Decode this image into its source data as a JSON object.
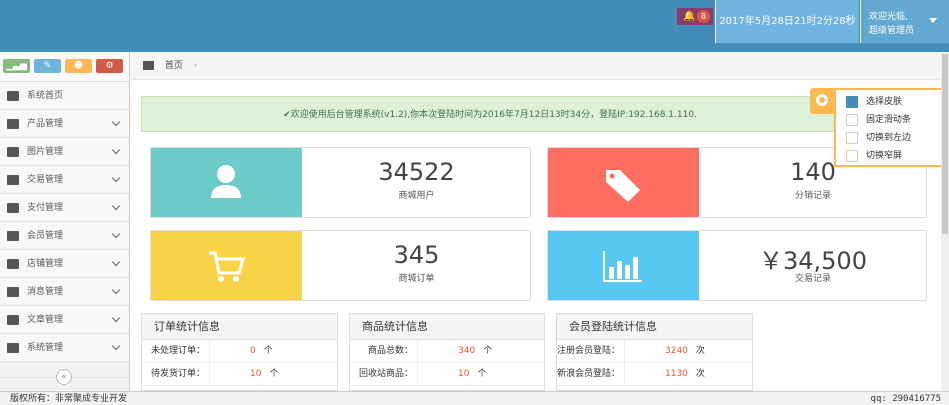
{
  "header": {
    "notification_count": "8",
    "datetime": "2017年5月28日21时2分28秒",
    "user_line1": "欢迎光临,",
    "user_line2": "超级管理员"
  },
  "shortcuts": [
    {
      "icon": "signal-icon",
      "color": "#87b87f"
    },
    {
      "icon": "pencil-icon",
      "color": "#6fb3e0"
    },
    {
      "icon": "users-icon",
      "color": "#ffb752"
    },
    {
      "icon": "cogs-icon",
      "color": "#d15b47"
    }
  ],
  "sidebar": {
    "items": [
      {
        "label": "系统首页",
        "icon": "home-icon"
      },
      {
        "label": "产品管理",
        "icon": "desktop-icon"
      },
      {
        "label": "图片管理",
        "icon": "picture-icon"
      },
      {
        "label": "交易管理",
        "icon": "list-icon"
      },
      {
        "label": "支付管理",
        "icon": "credit-card-icon"
      },
      {
        "label": "会员管理",
        "icon": "user-icon"
      },
      {
        "label": "店铺管理",
        "icon": "laptop-icon"
      },
      {
        "label": "消息管理",
        "icon": "comments-icon"
      },
      {
        "label": "文章管理",
        "icon": "bookmark-icon"
      },
      {
        "label": "系统管理",
        "icon": "cogs-icon"
      }
    ],
    "collapse_glyph": "«"
  },
  "breadcrumb": {
    "home": "首页",
    "sep": "›"
  },
  "welcome": "✔欢迎使用后台管理系统(v1.2),你本次登陆时间为2016年7月12日13时34分，登陆IP:192.168.1.110.",
  "cards": [
    {
      "value": "34522",
      "label": "商城用户",
      "color": "#6ccac9",
      "icon": "user-icon"
    },
    {
      "value": "140",
      "label": "分销记录",
      "color": "#ff6c60",
      "icon": "tags-icon"
    },
    {
      "value": "345",
      "label": "商城订单",
      "color": "#f8d347",
      "icon": "cart-icon"
    },
    {
      "value": "￥34,500",
      "label": "交易记录",
      "color": "#57c8f2",
      "icon": "bar-chart-icon"
    }
  ],
  "panels": [
    {
      "title": "订单统计信息",
      "rows": [
        {
          "k": "未处理订单：",
          "v": "0",
          "u": "个"
        },
        {
          "k": "待发货订单：",
          "v": "10",
          "u": "个"
        }
      ]
    },
    {
      "title": "商品统计信息",
      "rows": [
        {
          "k": "商品总数：",
          "v": "340",
          "u": "个"
        },
        {
          "k": "回收站商品：",
          "v": "10",
          "u": "个"
        }
      ]
    },
    {
      "title": "会员登陆统计信息",
      "rows": [
        {
          "k": "注册会员登陆：",
          "v": "3240",
          "u": "次"
        },
        {
          "k": "新浪会员登陆：",
          "v": "1130",
          "u": "次"
        }
      ]
    }
  ],
  "settings": {
    "options": [
      {
        "label": "选择皮肤",
        "selected": true
      },
      {
        "label": "固定滑动条",
        "selected": false
      },
      {
        "label": "切换到左边",
        "selected": false
      },
      {
        "label": "切换窄屏",
        "selected": false
      }
    ]
  },
  "footer": {
    "copyright": "版权所有：非常聚成专业开发",
    "qq": "qq: 290416775"
  }
}
